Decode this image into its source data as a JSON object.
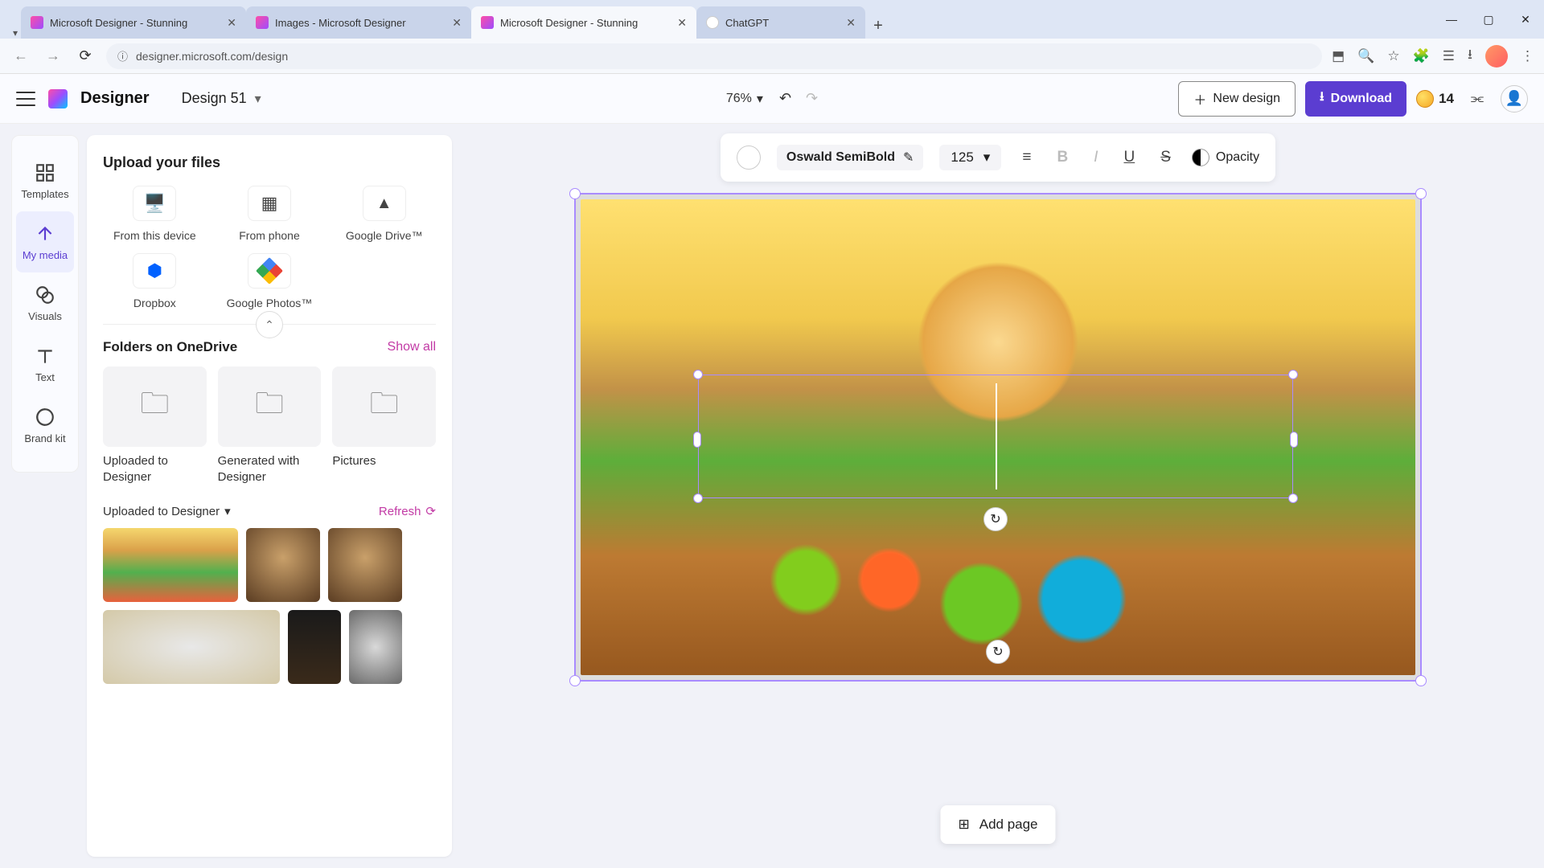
{
  "browser": {
    "tabs": [
      {
        "title": "Microsoft Designer - Stunning",
        "favicon": "designer"
      },
      {
        "title": "Images - Microsoft Designer",
        "favicon": "designer"
      },
      {
        "title": "Microsoft Designer - Stunning",
        "favicon": "designer",
        "active": true
      },
      {
        "title": "ChatGPT",
        "favicon": "chatgpt"
      }
    ],
    "url": "designer.microsoft.com/design"
  },
  "app": {
    "brand": "Designer",
    "project_name": "Design 51",
    "zoom": "76%",
    "new_design": "New design",
    "download": "Download",
    "credits": "14"
  },
  "rail": {
    "templates": "Templates",
    "my_media": "My media",
    "visuals": "Visuals",
    "text": "Text",
    "brand_kit": "Brand kit"
  },
  "panel": {
    "upload_title": "Upload your files",
    "from_device": "From this device",
    "from_phone": "From phone",
    "google_drive": "Google Drive™",
    "dropbox": "Dropbox",
    "google_photos": "Google Photos™",
    "folders_title": "Folders on OneDrive",
    "show_all": "Show all",
    "folders": [
      {
        "label": "Uploaded to Designer"
      },
      {
        "label": "Generated with Designer"
      },
      {
        "label": "Pictures"
      }
    ],
    "uploaded_title": "Uploaded to Designer",
    "refresh": "Refresh"
  },
  "toolbar": {
    "font": "Oswald SemiBold",
    "size": "125",
    "opacity": "Opacity"
  },
  "footer": {
    "add_page": "Add page"
  }
}
